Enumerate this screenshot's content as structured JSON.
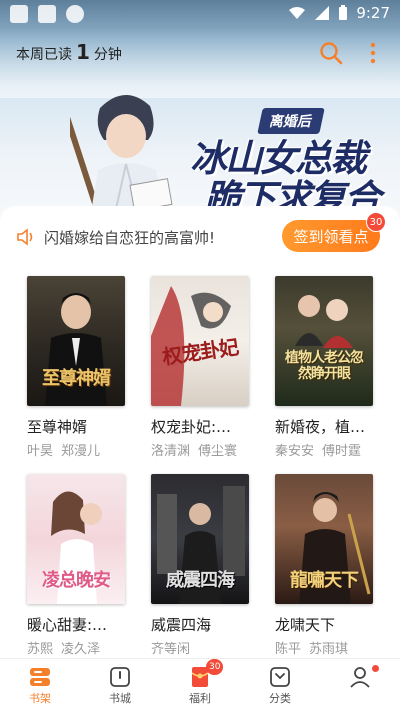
{
  "status_bar": {
    "time": "9:27"
  },
  "header": {
    "read_prefix": "本周已读",
    "read_minutes": "1",
    "read_suffix": "分钟"
  },
  "banner": {
    "subtitle": "离婚后",
    "title_line1": "冰山女总裁",
    "title_line2": "跪下求复合"
  },
  "notice": {
    "text": "闪婚嫁给自恋狂的高富帅!",
    "signin_label": "签到领看点",
    "signin_badge": "30"
  },
  "books": [
    {
      "title": "至尊神婿",
      "cover_text": "至尊神婿",
      "authors": [
        "叶昊",
        "郑漫儿"
      ]
    },
    {
      "title": "权宠卦妃:…",
      "cover_text": "权宠卦妃",
      "authors": [
        "洛清渊",
        "傅尘寰"
      ]
    },
    {
      "title": "新婚夜，植…",
      "cover_text": "植物人老公忽然睁开眼",
      "authors": [
        "秦安安",
        "傅时霆"
      ]
    },
    {
      "title": "暖心甜妻:…",
      "cover_text": "凌总晚安",
      "authors": [
        "苏熙",
        "凌久泽"
      ]
    },
    {
      "title": "威震四海",
      "cover_text": "威震四海",
      "authors": [
        "齐等闲"
      ]
    },
    {
      "title": "龙啸天下",
      "cover_text": "龍嘯天下",
      "authors": [
        "陈平",
        "苏雨琪"
      ]
    }
  ],
  "tabs": [
    {
      "label": "书架",
      "icon": "bookshelf-icon",
      "active": true
    },
    {
      "label": "书城",
      "icon": "bookstore-icon"
    },
    {
      "label": "福利",
      "icon": "gift-envelope-icon",
      "badge": "30"
    },
    {
      "label": "分类",
      "icon": "category-icon"
    },
    {
      "label": "",
      "icon": "profile-icon",
      "dot": true
    }
  ],
  "colors": {
    "accent": "#f5802c",
    "badge": "#f24b39",
    "banner_text": "#1e2c66"
  }
}
